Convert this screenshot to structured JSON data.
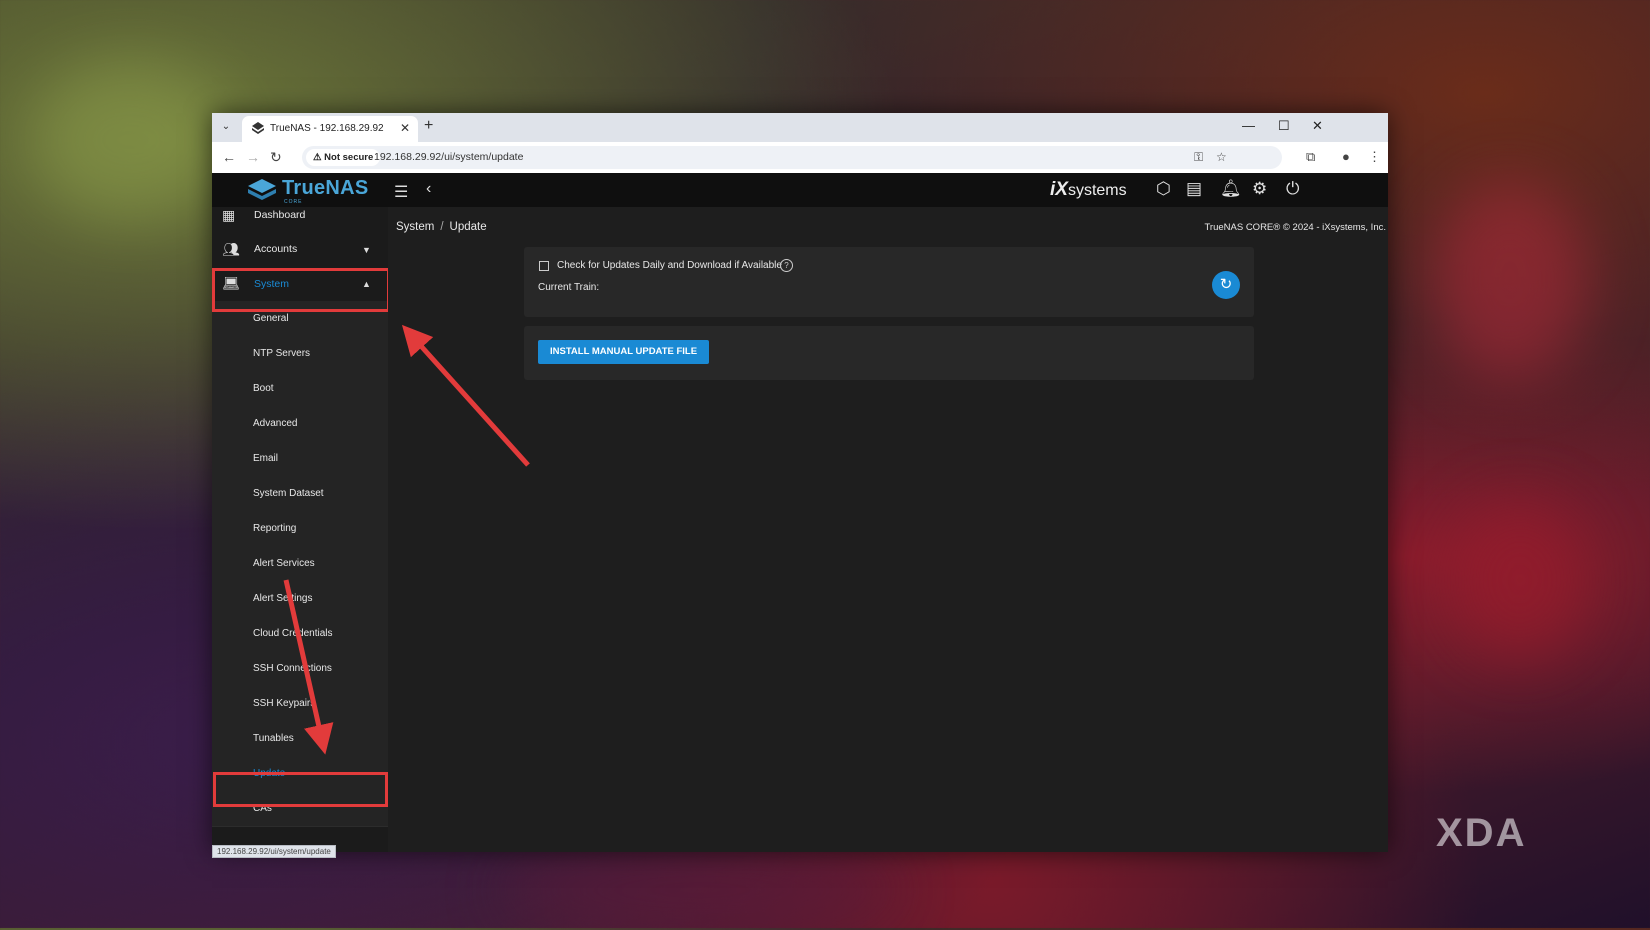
{
  "browser": {
    "tab_title": "TrueNAS - 192.168.29.92",
    "security_label": "Not secure",
    "url": "192.168.29.92/ui/system/update",
    "status_url": "192.168.29.92/ui/system/update"
  },
  "app": {
    "logo_text": "TrueNAS",
    "logo_sub": "CORE",
    "brand": "systems",
    "brand_prefix": "iX",
    "accent_color": "#1a8ad4"
  },
  "sidebar": {
    "dashboard": "Dashboard",
    "accounts": "Accounts",
    "system": "System",
    "items": [
      "General",
      "NTP Servers",
      "Boot",
      "Advanced",
      "Email",
      "System Dataset",
      "Reporting",
      "Alert Services",
      "Alert Settings",
      "Cloud Credentials",
      "SSH Connections",
      "SSH Keypairs",
      "Tunables",
      "Update",
      "CAs"
    ]
  },
  "main": {
    "breadcrumb_parent": "System",
    "breadcrumb_sep": "/",
    "breadcrumb_current": "Update",
    "copyright": "TrueNAS CORE® © 2024 - iXsystems, Inc.",
    "check_label": "Check for Updates Daily and Download if Available",
    "current_train_label": "Current Train:",
    "install_button": "INSTALL MANUAL UPDATE FILE"
  },
  "watermark": "XDA"
}
